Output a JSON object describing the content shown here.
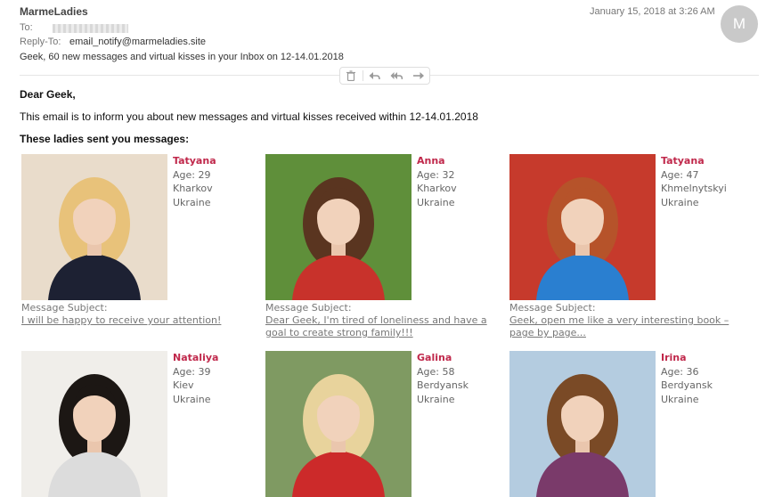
{
  "header": {
    "from": "MarmeLadies",
    "date": "January 15, 2018 at 3:26 AM",
    "avatar_letter": "M",
    "to_label": "To:",
    "reply_to_label": "Reply-To:",
    "reply_to": "email_notify@marmeladies.site",
    "subject": "Geek, 60 new messages and virtual kisses in your Inbox on 12-14.01.2018"
  },
  "toolbar": {
    "icons": [
      "trash-icon",
      "reply-icon",
      "reply-all-icon",
      "forward-icon"
    ]
  },
  "body": {
    "greeting": "Dear Geek,",
    "intro": "This email is to inform you about new messages and virtual kisses received within 12-14.01.2018",
    "heading": "These ladies sent you messages:",
    "message_label": "Message Subject:"
  },
  "profiles": [
    {
      "name": "Tatyana",
      "age": "Age: 29",
      "city": "Kharkov",
      "country": "Ukraine",
      "subject": "I will be happy to receive your attention!",
      "bg": "#e9dccb",
      "hair": "#e8c27a",
      "top": "#1d2133"
    },
    {
      "name": "Anna",
      "age": "Age: 32",
      "city": "Kharkov",
      "country": "Ukraine",
      "subject": "Dear Geek, I'm tired of loneliness and have a goal to create strong family!!!",
      "bg": "#5f8f3a",
      "hair": "#5a3520",
      "top": "#c8322b"
    },
    {
      "name": "Tatyana",
      "age": "Age: 47",
      "city": "Khmelnytskyi",
      "country": "Ukraine",
      "subject": "Geek, open me like a very interesting book – page by page...",
      "bg": "#c63a2c",
      "hair": "#b6532a",
      "top": "#2a7fd0"
    },
    {
      "name": "Nataliya",
      "age": "Age: 39",
      "city": "Kiev",
      "country": "Ukraine",
      "subject": "",
      "bg": "#f0eeea",
      "hair": "#1c1714",
      "top": "#dcdcdc"
    },
    {
      "name": "Galina",
      "age": "Age: 58",
      "city": "Berdyansk",
      "country": "Ukraine",
      "subject": "",
      "bg": "#7f9a62",
      "hair": "#e8d39c",
      "top": "#cc2a2a"
    },
    {
      "name": "Irina",
      "age": "Age: 36",
      "city": "Berdyansk",
      "country": "Ukraine",
      "subject": "",
      "bg": "#b4cce0",
      "hair": "#7a4a26",
      "top": "#7a3a6a"
    }
  ]
}
